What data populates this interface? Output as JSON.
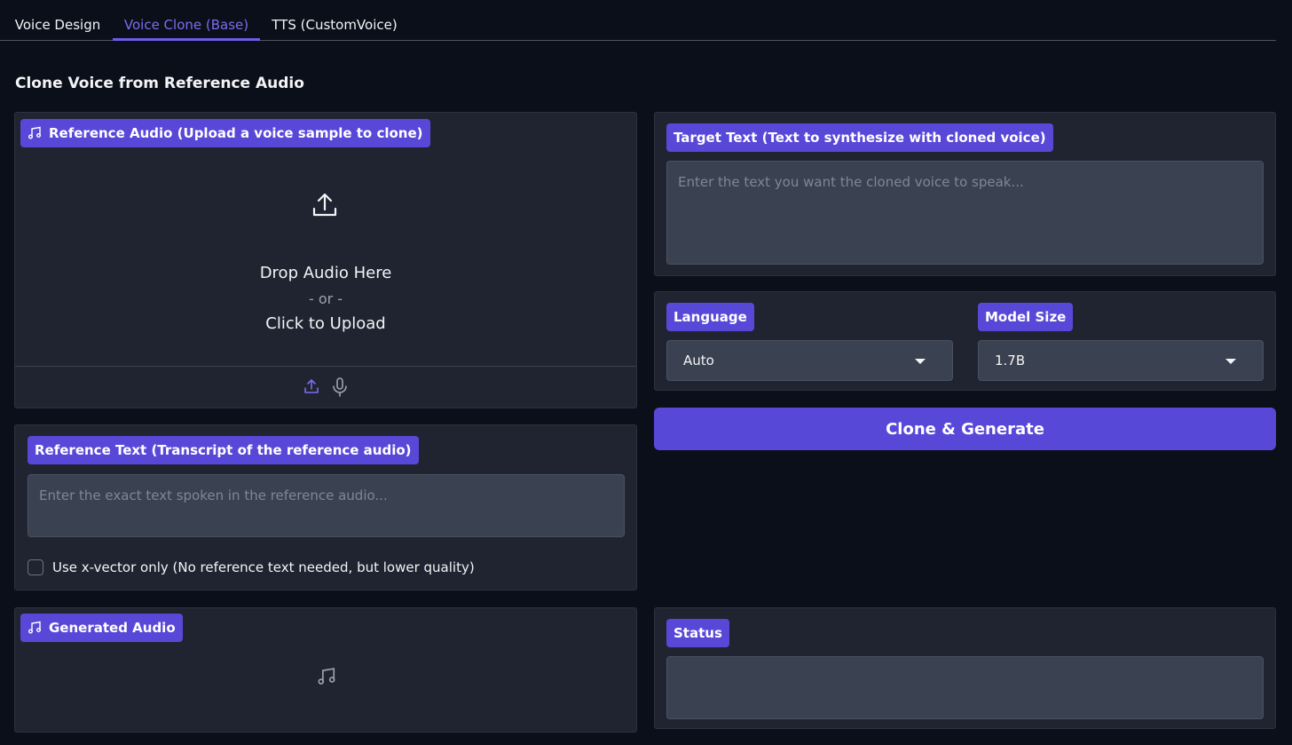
{
  "tabs": [
    {
      "label": "Voice Design"
    },
    {
      "label": "Voice Clone (Base)"
    },
    {
      "label": "TTS (CustomVoice)"
    }
  ],
  "page_title": "Clone Voice from Reference Audio",
  "reference_audio": {
    "label": "Reference Audio (Upload a voice sample to clone)",
    "drop_text": "Drop Audio Here",
    "or_text": "- or -",
    "click_text": "Click to Upload"
  },
  "reference_text": {
    "label": "Reference Text (Transcript of the reference audio)",
    "placeholder": "Enter the exact text spoken in the reference audio...",
    "checkbox_label": "Use x-vector only (No reference text needed, but lower quality)"
  },
  "generated_audio": {
    "label": "Generated Audio"
  },
  "target_text": {
    "label": "Target Text (Text to synthesize with cloned voice)",
    "placeholder": "Enter the text you want the cloned voice to speak..."
  },
  "language": {
    "label": "Language",
    "value": "Auto"
  },
  "model_size": {
    "label": "Model Size",
    "value": "1.7B"
  },
  "generate_button": {
    "label": "Clone & Generate"
  },
  "status": {
    "label": "Status",
    "value": ""
  },
  "colors": {
    "accent": "#5848d8",
    "background": "#0b0f19",
    "panel": "#1f2430"
  }
}
